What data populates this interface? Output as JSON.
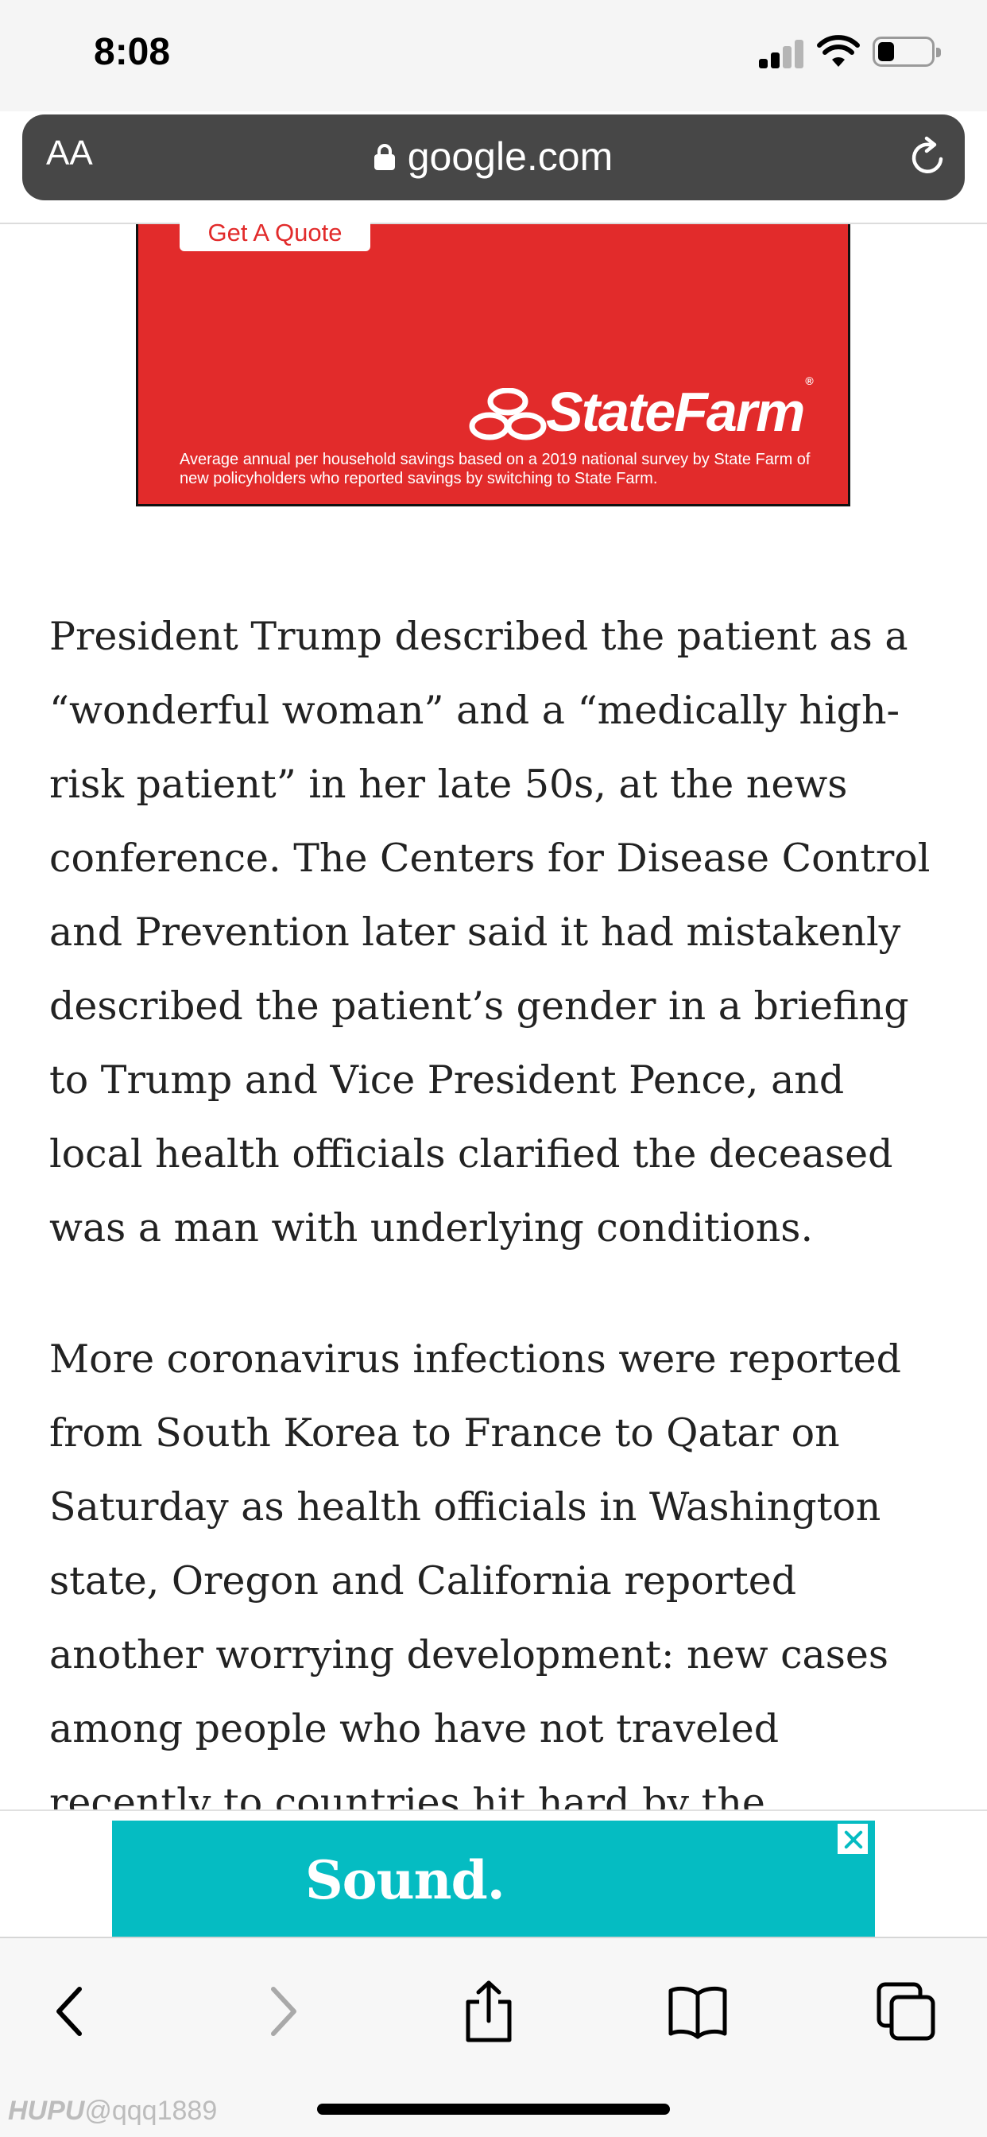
{
  "status_bar": {
    "time": "8:08"
  },
  "browser": {
    "text_size_label": "AA",
    "url": "google.com"
  },
  "ad_top": {
    "button_label": "Get A Quote",
    "brand": "StateFarm",
    "brand_mark": "®",
    "disclaimer": "Average annual per household savings based on a 2019 national survey by State Farm of new policyholders who reported savings by switching to State Farm.",
    "background_color": "#e22b2b"
  },
  "article": {
    "paragraphs": [
      "President Trump described the patient as a “wonderful woman” and a “medically high-risk patient” in her late 50s, at the news conference. The Centers for Disease Control and Prevention later said it had mistakenly described the patient’s gender in a briefing to Trump and Vice President Pence, and local health officials clarified the deceased was a man with underlying conditions.",
      "More coronavirus infections were reported from South Korea to France to Qatar on Saturday as health officials in Washington state, Oregon and California reported another worrying development: new cases among people who have not traveled recently to countries hit hard by the outbreak or come"
    ]
  },
  "ad_bottom": {
    "text": "Sound.",
    "background_color": "#05bcc2"
  },
  "toolbar": {
    "icons": [
      "back-icon",
      "forward-icon",
      "share-icon",
      "bookmarks-icon",
      "tabs-icon"
    ]
  },
  "watermark": {
    "brand": "HUPU",
    "handle": "@qqq1889"
  }
}
